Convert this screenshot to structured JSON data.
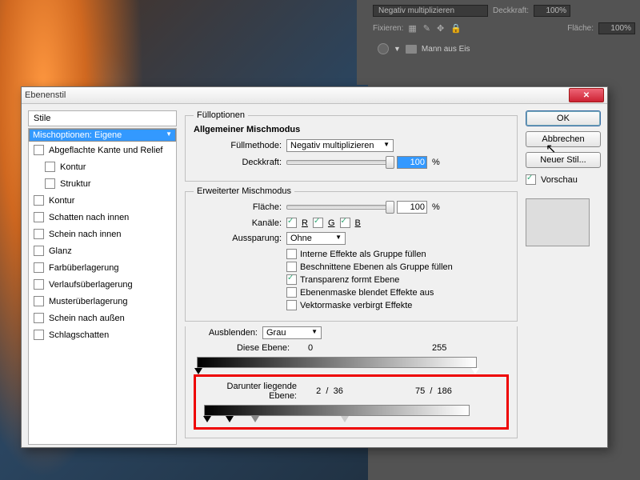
{
  "panel": {
    "blendMode": "Negativ multiplizieren",
    "opacityLabel": "Deckkraft:",
    "opacityValue": "100%",
    "lockLabel": "Fixieren:",
    "fillLabel": "Fläche:",
    "fillValue": "100%",
    "layerName": "Mann aus Eis"
  },
  "dialog": {
    "title": "Ebenenstil",
    "stylesHeader": "Stile",
    "styles": [
      "Mischoptionen: Eigene",
      "Abgeflachte Kante und Relief",
      "Kontur",
      "Struktur",
      "Kontur",
      "Schatten nach innen",
      "Schein nach innen",
      "Glanz",
      "Farbüberlagerung",
      "Verlaufsüberlagerung",
      "Musterüberlagerung",
      "Schein nach außen",
      "Schlagschatten"
    ],
    "fillOptions": {
      "legend": "Fülloptionen",
      "generalHeader": "Allgemeiner Mischmodus",
      "fillMethodLabel": "Füllmethode:",
      "fillMethod": "Negativ multiplizieren",
      "opacityLabel": "Deckkraft:",
      "opacity": "100"
    },
    "advanced": {
      "legend": "Erweiterter Mischmodus",
      "areaLabel": "Fläche:",
      "area": "100",
      "channelsLabel": "Kanäle:",
      "chR": "R",
      "chG": "G",
      "chB": "B",
      "knockoutLabel": "Aussparung:",
      "knockout": "Ohne",
      "c1": "Interne Effekte als Gruppe füllen",
      "c2": "Beschnittene Ebenen als Gruppe füllen",
      "c3": "Transparenz formt Ebene",
      "c4": "Ebenenmaske blendet Effekte aus",
      "c5": "Vektormaske verbirgt Effekte"
    },
    "blendIf": {
      "label": "Ausblenden:",
      "mode": "Grau",
      "thisLabel": "Diese Ebene:",
      "thisLow": "0",
      "thisHigh": "255",
      "underLabel": "Darunter liegende Ebene:",
      "underLow1": "2",
      "underLow2": "36",
      "underHigh1": "75",
      "underHigh2": "186"
    },
    "buttons": {
      "ok": "OK",
      "cancel": "Abbrechen",
      "newStyle": "Neuer Stil...",
      "preview": "Vorschau"
    }
  }
}
